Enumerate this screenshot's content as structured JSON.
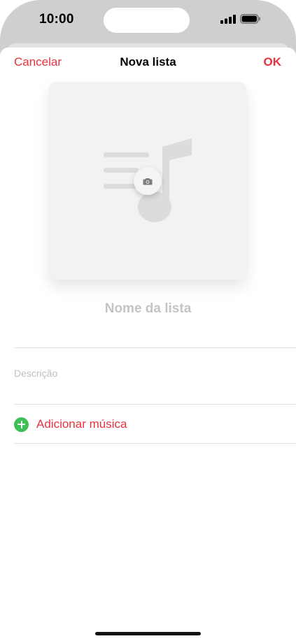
{
  "status_bar": {
    "time": "10:00",
    "icons": [
      "cellular-signal-icon",
      "battery-icon"
    ]
  },
  "nav": {
    "cancel_label": "Cancelar",
    "title": "Nova lista",
    "ok_label": "OK"
  },
  "artwork": {
    "placeholder_icon": "music-note-icon",
    "action_icon": "camera-icon"
  },
  "form": {
    "name_placeholder": "Nome da lista",
    "description_placeholder": "Descrição",
    "add_music_label": "Adicionar música"
  },
  "colors": {
    "accent": "#e8323f",
    "add_icon": "#3fbf57",
    "placeholder_text": "#c4c4c4"
  }
}
